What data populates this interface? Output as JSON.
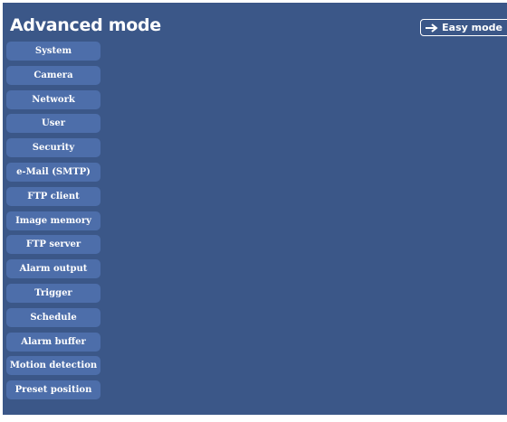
{
  "header": {
    "title": "Advanced mode",
    "easy_mode_label": "Easy mode",
    "easy_mode_icon": "arrow-right-icon"
  },
  "menu": {
    "items": [
      {
        "label": "System"
      },
      {
        "label": "Camera"
      },
      {
        "label": "Network"
      },
      {
        "label": "User"
      },
      {
        "label": "Security"
      },
      {
        "label": "e-Mail (SMTP)"
      },
      {
        "label": "FTP client"
      },
      {
        "label": "Image memory"
      },
      {
        "label": "FTP server"
      },
      {
        "label": "Alarm output"
      },
      {
        "label": "Trigger"
      },
      {
        "label": "Schedule"
      },
      {
        "label": "Alarm buffer"
      },
      {
        "label": "Motion detection"
      },
      {
        "label": "Preset position"
      }
    ]
  },
  "colors": {
    "background": "#3b5788",
    "menu_item": "#4d6eaa",
    "text": "#ffffff"
  }
}
